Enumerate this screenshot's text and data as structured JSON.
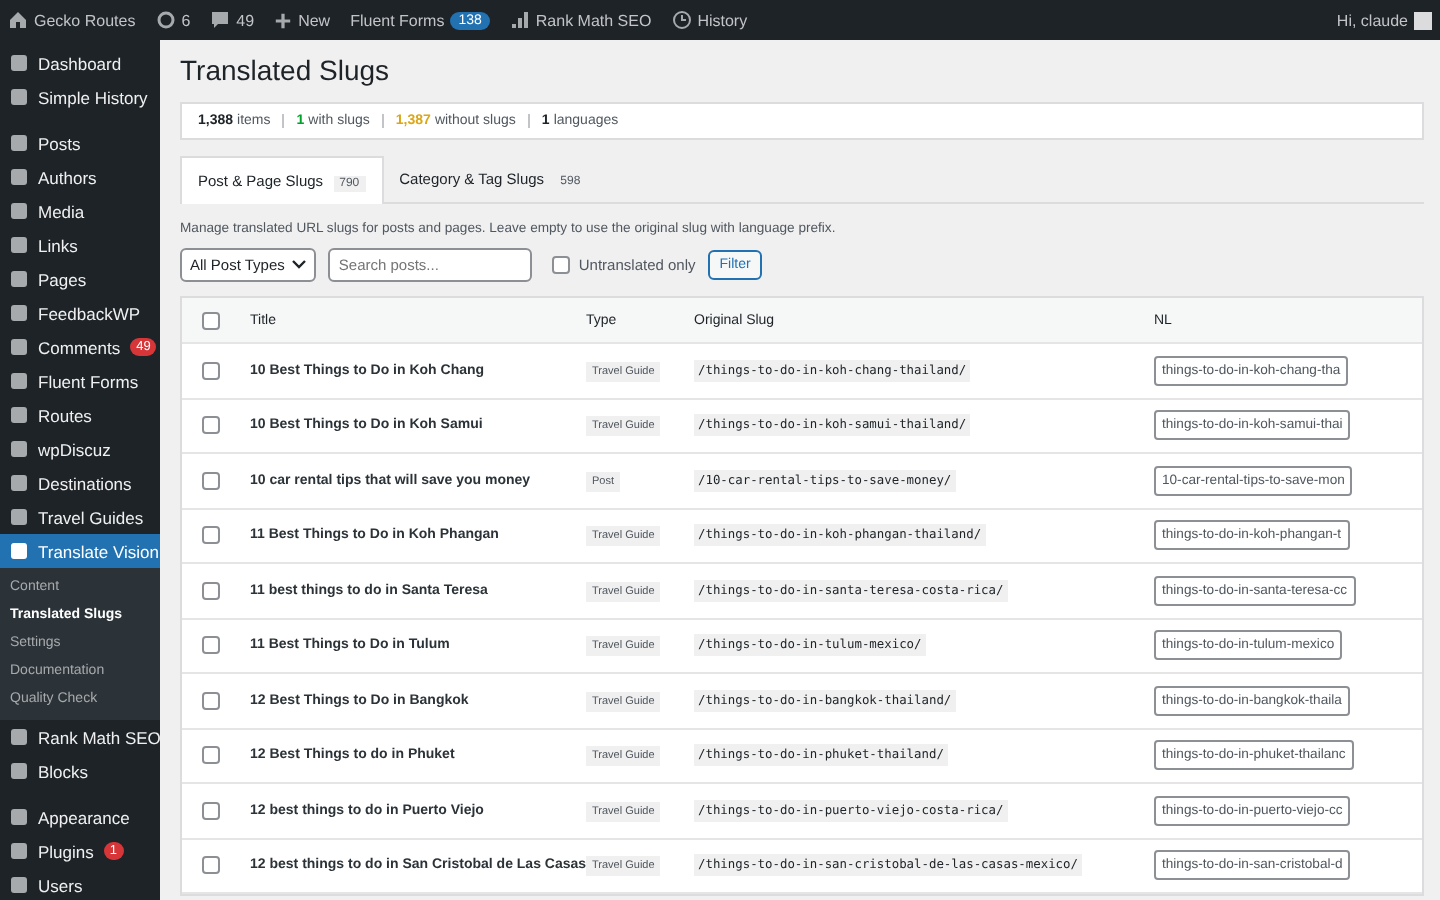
{
  "admin_bar": {
    "items": [
      {
        "kind": "home",
        "label": "Gecko Routes"
      },
      {
        "kind": "updates",
        "label": "6"
      },
      {
        "kind": "comments",
        "label": "49"
      },
      {
        "kind": "new",
        "label": "New"
      },
      {
        "kind": "plain",
        "label": "Fluent Forms",
        "badge": "138"
      },
      {
        "kind": "chart",
        "label": "Rank Math SEO"
      },
      {
        "kind": "clock",
        "label": "History"
      }
    ],
    "greeting": "Hi, claude"
  },
  "sidebar": {
    "groups": [
      [
        {
          "label": "Dashboard",
          "selected": false
        },
        {
          "label": "Simple History",
          "selected": false
        }
      ],
      [
        {
          "label": "Posts",
          "selected": false
        },
        {
          "label": "Authors",
          "selected": false
        },
        {
          "label": "Media",
          "selected": false
        },
        {
          "label": "Links",
          "selected": false
        },
        {
          "label": "Pages",
          "selected": false
        },
        {
          "label": "FeedbackWP",
          "selected": false
        },
        {
          "label": "Comments",
          "selected": false,
          "badge": "49"
        },
        {
          "label": "Fluent Forms",
          "selected": false
        },
        {
          "label": "Routes",
          "selected": false
        },
        {
          "label": "wpDiscuz",
          "selected": false
        },
        {
          "label": "Destinations",
          "selected": false
        },
        {
          "label": "Travel Guides",
          "selected": false
        },
        {
          "label": "Translate Vision",
          "selected": true,
          "children": [
            {
              "label": "Content",
              "selected": false
            },
            {
              "label": "Translated Slugs",
              "selected": true
            },
            {
              "label": "Settings",
              "selected": false
            },
            {
              "label": "Documentation",
              "selected": false
            },
            {
              "label": "Quality Check",
              "selected": false
            }
          ]
        },
        {
          "label": "Rank Math SEO",
          "selected": false
        },
        {
          "label": "Blocks",
          "selected": false
        }
      ],
      [
        {
          "label": "Appearance",
          "selected": false
        },
        {
          "label": "Plugins",
          "selected": false,
          "badge": "1"
        },
        {
          "label": "Users",
          "selected": false
        }
      ]
    ]
  },
  "page_title": "Translated Slugs",
  "stats": [
    {
      "number": "1,388",
      "caption": "items",
      "color": "#1d2327"
    },
    {
      "number": "1",
      "caption": "with slugs",
      "color": "#00a32a"
    },
    {
      "number": "1,387",
      "caption": "without slugs",
      "color": "#dba617"
    },
    {
      "number": "1",
      "caption": "languages",
      "color": "#1d2327"
    }
  ],
  "tabs": [
    {
      "label": "Post & Page Slugs",
      "count": "790",
      "selected": true
    },
    {
      "label": "Category & Tag Slugs",
      "count": "598",
      "selected": false
    }
  ],
  "description": "Manage translated URL slugs for posts and pages. Leave empty to use the original slug with language prefix.",
  "filters": {
    "post_type": "All Post Types",
    "search_placeholder": "Search posts...",
    "untranslated_label": "Untranslated only",
    "untranslated_checked": false,
    "button": "Filter"
  },
  "table": {
    "columns": [
      "Title",
      "Type",
      "Original Slug",
      "NL"
    ],
    "select_all_checked": false,
    "rows": [
      {
        "checked": false,
        "title": "10 Best Things to Do in Koh Chang",
        "type": "Travel Guide",
        "slug": "/things-to-do-in-koh-chang-thailand/",
        "nl": "things-to-do-in-koh-chang-tha"
      },
      {
        "checked": false,
        "title": "10 Best Things to Do in Koh Samui",
        "type": "Travel Guide",
        "slug": "/things-to-do-in-koh-samui-thailand/",
        "nl": "things-to-do-in-koh-samui-thai"
      },
      {
        "checked": false,
        "title": "10 car rental tips that will save you money",
        "type": "Post",
        "slug": "/10-car-rental-tips-to-save-money/",
        "nl": "10-car-rental-tips-to-save-mon"
      },
      {
        "checked": false,
        "title": "11 Best Things to Do in Koh Phangan",
        "type": "Travel Guide",
        "slug": "/things-to-do-in-koh-phangan-thailand/",
        "nl": "things-to-do-in-koh-phangan-t"
      },
      {
        "checked": false,
        "title": "11 best things to do in Santa Teresa",
        "type": "Travel Guide",
        "slug": "/things-to-do-in-santa-teresa-costa-rica/",
        "nl": "things-to-do-in-santa-teresa-cc"
      },
      {
        "checked": false,
        "title": "11 Best Things to Do in Tulum",
        "type": "Travel Guide",
        "slug": "/things-to-do-in-tulum-mexico/",
        "nl": "things-to-do-in-tulum-mexico"
      },
      {
        "checked": false,
        "title": "12 Best Things to Do in Bangkok",
        "type": "Travel Guide",
        "slug": "/things-to-do-in-bangkok-thailand/",
        "nl": "things-to-do-in-bangkok-thaila"
      },
      {
        "checked": false,
        "title": "12 Best Things to do in Phuket",
        "type": "Travel Guide",
        "slug": "/things-to-do-in-phuket-thailand/",
        "nl": "things-to-do-in-phuket-thailanc"
      },
      {
        "checked": false,
        "title": "12 best things to do in Puerto Viejo",
        "type": "Travel Guide",
        "slug": "/things-to-do-in-puerto-viejo-costa-rica/",
        "nl": "things-to-do-in-puerto-viejo-cc"
      },
      {
        "checked": false,
        "title": "12 best things to do in San Cristobal de Las Casas",
        "type": "Travel Guide",
        "slug": "/things-to-do-in-san-cristobal-de-las-casas-mexico/",
        "nl": "things-to-do-in-san-cristobal-d"
      }
    ]
  }
}
